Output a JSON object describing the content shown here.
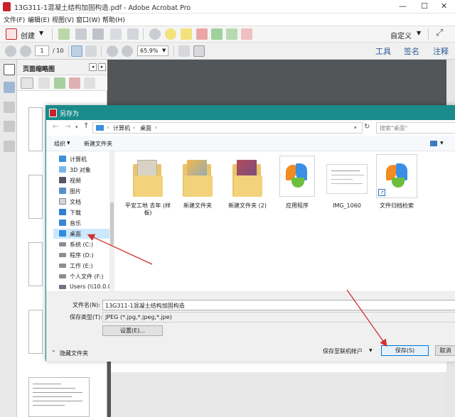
{
  "window": {
    "title": "13G311-1混凝土结构加固构造.pdf - Adobe Acrobat Pro",
    "controls": [
      "—",
      "☐",
      "✕"
    ]
  },
  "menu": [
    "文件(F)",
    "编辑(E)",
    "视图(V)",
    "窗口(W)",
    "帮助(H)"
  ],
  "toolbar": {
    "create_label": "创建",
    "customize_label": "自定义",
    "page_current": "1",
    "page_total": "/ 10",
    "zoom": "65.9%",
    "right_tabs": [
      "工具",
      "签名",
      "注释"
    ]
  },
  "thumbpane": {
    "title": "页面缩略图"
  },
  "dialog": {
    "title": "另存为",
    "breadcrumb": [
      "计算机",
      "桌面"
    ],
    "search_placeholder": "搜索\"桌面\"",
    "organize_label": "组织",
    "new_folder_label": "新建文件夹",
    "tree": [
      {
        "label": "计算机",
        "icon": "computer-icon"
      },
      {
        "label": "3D 对象",
        "icon": "3d-objects-icon"
      },
      {
        "label": "视频",
        "icon": "video-icon"
      },
      {
        "label": "图片",
        "icon": "pictures-icon"
      },
      {
        "label": "文档",
        "icon": "documents-icon"
      },
      {
        "label": "下载",
        "icon": "download-icon"
      },
      {
        "label": "音乐",
        "icon": "music-icon"
      },
      {
        "label": "桌面",
        "icon": "desktop-icon",
        "selected": true
      },
      {
        "label": "系统 (C:)",
        "icon": "drive-icon"
      },
      {
        "label": "程序 (D:)",
        "icon": "drive-icon"
      },
      {
        "label": "工作 (E:)",
        "icon": "drive-icon"
      },
      {
        "label": "个人文件 (F:)",
        "icon": "drive-icon"
      },
      {
        "label": "Users (\\\\10.0.0",
        "icon": "network-drive-icon"
      }
    ],
    "files": [
      {
        "label": "平安工地   去年 (样板)",
        "type": "folder"
      },
      {
        "label": "新建文件夹",
        "type": "folder"
      },
      {
        "label": "新建文件夹 (2)",
        "type": "folder"
      },
      {
        "label": "应用程序",
        "type": "app"
      },
      {
        "label": "IMG_1060",
        "type": "image"
      },
      {
        "label": "文件归档检索",
        "type": "shortcut"
      }
    ],
    "filename_label": "文件名(N):",
    "filename_value": "13G311-1混凝土结构加固构造",
    "filetype_label": "保存类型(T):",
    "filetype_value": "JPEG (*.jpg,*.jpeg,*.jpe)",
    "settings_button": "设置(E)...",
    "hide_folders_label": "隐藏文件夹",
    "save_online_label": "保存至联机帐户",
    "save_button": "保存(S)",
    "cancel_button": "取消"
  },
  "colors": {
    "dialog_title": "#1a8a8a",
    "arrow": "#d0312d",
    "selected_item": "#cce8ff"
  }
}
